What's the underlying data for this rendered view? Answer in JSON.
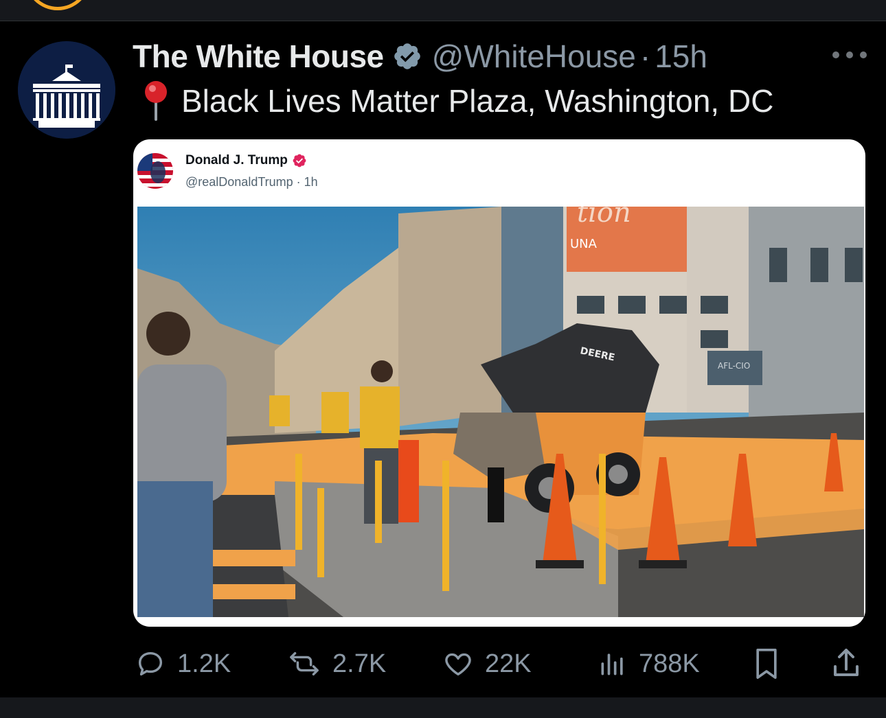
{
  "tweet": {
    "author_name": "The White House",
    "handle": "@WhiteHouse",
    "separator": "·",
    "time": "15h",
    "location_text": "Black Lives Matter Plaza, Washington, DC"
  },
  "quoted": {
    "author_name": "Donald J. Trump",
    "handle_time": "@realDonaldTrump · 1h",
    "video_signs": {
      "banner": "tion",
      "banner_sub": "UNA",
      "machine": "DEERE",
      "building": "AFL-CIO"
    }
  },
  "actions": {
    "replies": "1.2K",
    "reposts": "2.7K",
    "likes": "22K",
    "views": "788K"
  },
  "colors": {
    "background": "#000000",
    "muted_text": "#8b98a5",
    "verified_blue": "#1d9bf0",
    "verified_red": "#e0245e",
    "plaza_orange": "#f0a24a"
  },
  "icons": [
    "more-icon",
    "verified-icon",
    "pin-icon",
    "mute-icon",
    "reply-icon",
    "repost-icon",
    "like-icon",
    "views-icon",
    "bookmark-icon",
    "share-icon"
  ]
}
